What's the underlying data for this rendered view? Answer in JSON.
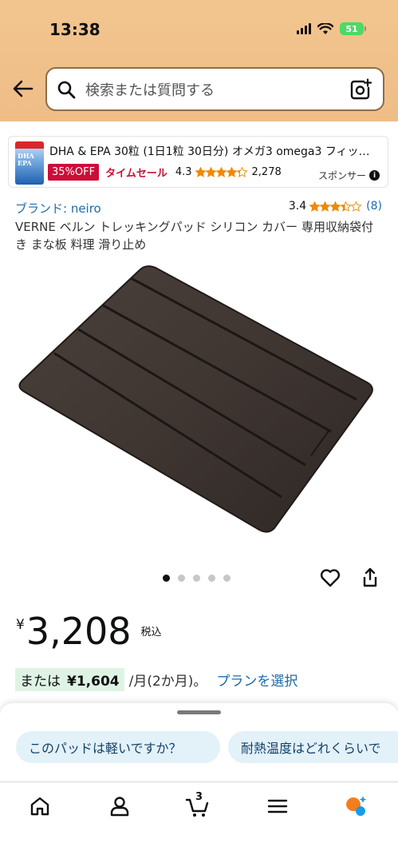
{
  "status": {
    "time": "13:38",
    "battery": "51"
  },
  "search": {
    "placeholder": "検索または質問する"
  },
  "ad": {
    "thumb_text": "DHA\nEPA",
    "title": "DHA & EPA 30粒 (1日1粒 30日分) オメガ3 omega3 フィッ…",
    "badge": "35%OFF",
    "deal": "タイムセール",
    "rating": "4.3",
    "count": "2,278",
    "sponsor": "スポンサー"
  },
  "product": {
    "brand": "ブランド: neiro",
    "rating": "3.4",
    "review_count": "(8)",
    "title": "VERNE ベルン トレッキングパッド シリコン カバー 専用収納袋付き まな板 料理 滑り止め",
    "image_count": 5,
    "image_index": 1
  },
  "price": {
    "currency": "¥",
    "amount": "3,208",
    "tax": "税込"
  },
  "installment": {
    "prefix": "または",
    "amount": "¥1,604",
    "period": "/月(2か月)。",
    "plan_link": "プランを選択"
  },
  "suggestions": [
    "このパッドは軽いですか？",
    "耐熱温度はどれくらいで"
  ],
  "tabs": {
    "cart_count": "3"
  },
  "colors": {
    "header": "#f0c08a",
    "link": "#1f6aa8",
    "deal": "#cc0c39",
    "star": "#f08804"
  }
}
